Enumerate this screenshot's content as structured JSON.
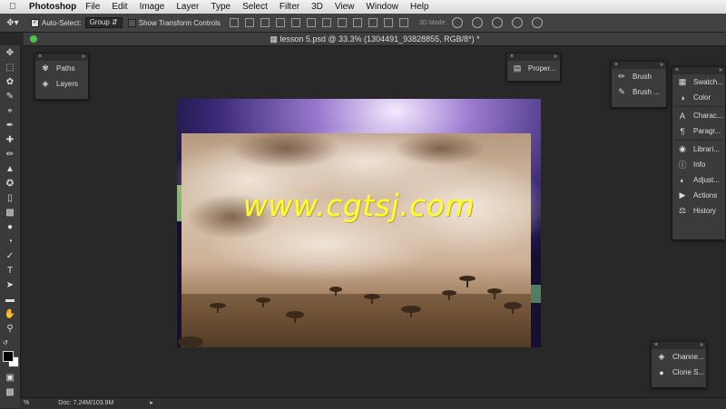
{
  "menubar": {
    "app_name": "Photoshop",
    "items": [
      "File",
      "Edit",
      "Image",
      "Layer",
      "Type",
      "Select",
      "Filter",
      "3D",
      "View",
      "Window",
      "Help"
    ]
  },
  "options": {
    "auto_select_label": "Auto-Select:",
    "auto_select_value": "Group",
    "transform_label": "Show Transform Controls",
    "mode3d_label": "3D Mode:"
  },
  "document": {
    "title": "lesson 5.psd @ 33.3% (1304491_93828855, RGB/8*) *",
    "watermark": "www.cgtsj.com"
  },
  "panels": {
    "left": {
      "items": [
        {
          "icon": "paths-icon",
          "label": "Paths"
        },
        {
          "icon": "layers-icon",
          "label": "Layers"
        }
      ]
    },
    "properties": {
      "label": "Proper..."
    },
    "brush": {
      "items": [
        {
          "icon": "brush-icon",
          "label": "Brush"
        },
        {
          "icon": "brush-presets-icon",
          "label": "Brush ..."
        }
      ]
    },
    "right": {
      "items": [
        {
          "icon": "swatches-icon",
          "label": "Swatch..."
        },
        {
          "icon": "color-icon",
          "label": "Color"
        },
        {
          "icon": "character-icon",
          "label": "Charac..."
        },
        {
          "icon": "paragraph-icon",
          "label": "Paragr..."
        },
        {
          "icon": "libraries-icon",
          "label": "Librari..."
        },
        {
          "icon": "info-icon",
          "label": "Info"
        },
        {
          "icon": "adjustments-icon",
          "label": "Adjust..."
        },
        {
          "icon": "actions-icon",
          "label": "Actions"
        },
        {
          "icon": "history-icon",
          "label": "History"
        }
      ]
    },
    "bottom_right": {
      "items": [
        {
          "icon": "channels-icon",
          "label": "Channe..."
        },
        {
          "icon": "clone-source-icon",
          "label": "Clone S..."
        }
      ]
    }
  },
  "status": {
    "zoom": "%",
    "doc": "Doc: 7.24M/103.9M"
  }
}
